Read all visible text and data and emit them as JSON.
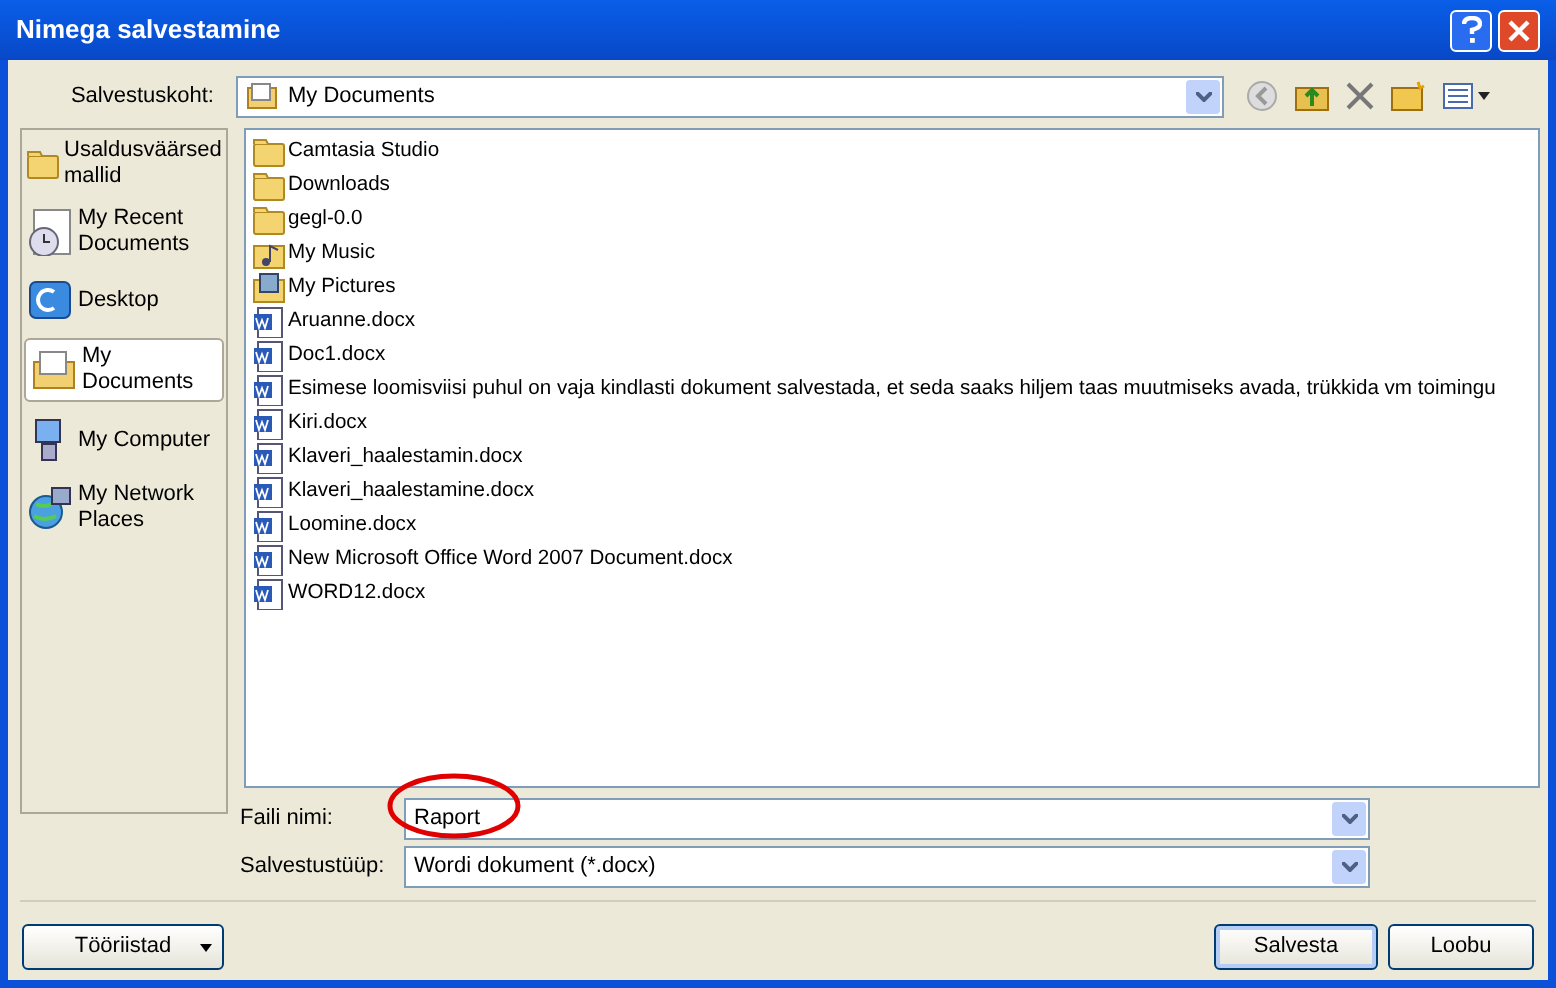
{
  "window": {
    "title": "Nimega salvestamine"
  },
  "location": {
    "label": "Salvestuskoht:",
    "value": "My Documents"
  },
  "places": [
    {
      "label": "Usaldusväärsed mallid",
      "kind": "folder",
      "selected": false
    },
    {
      "label": "My Recent Documents",
      "kind": "recent",
      "selected": false
    },
    {
      "label": "Desktop",
      "kind": "desktop",
      "selected": false
    },
    {
      "label": "My Documents",
      "kind": "documents",
      "selected": true
    },
    {
      "label": "My Computer",
      "kind": "computer",
      "selected": false
    },
    {
      "label": "My Network Places",
      "kind": "network",
      "selected": false
    }
  ],
  "files": [
    {
      "name": "Camtasia Studio",
      "kind": "folder"
    },
    {
      "name": "Downloads",
      "kind": "folder"
    },
    {
      "name": "gegl-0.0",
      "kind": "folder"
    },
    {
      "name": "My Music",
      "kind": "music"
    },
    {
      "name": "My Pictures",
      "kind": "pictures"
    },
    {
      "name": "Aruanne.docx",
      "kind": "doc"
    },
    {
      "name": "Doc1.docx",
      "kind": "doc"
    },
    {
      "name": "Esimese loomisviisi puhul on vaja kindlasti dokument salvestada, et seda saaks hiljem taas muutmiseks avada, trükkida vm toimingu",
      "kind": "doc"
    },
    {
      "name": "Kiri.docx",
      "kind": "doc"
    },
    {
      "name": "Klaveri_haalestamin.docx",
      "kind": "doc"
    },
    {
      "name": "Klaveri_haalestamine.docx",
      "kind": "doc"
    },
    {
      "name": "Loomine.docx",
      "kind": "doc"
    },
    {
      "name": "New Microsoft Office Word 2007 Document.docx",
      "kind": "doc"
    },
    {
      "name": "WORD12.docx",
      "kind": "doc"
    }
  ],
  "filename": {
    "label": "Faili nimi:",
    "value": "Raport",
    "highlighted": true
  },
  "filetype": {
    "label": "Salvestustüüp:",
    "value": "Wordi dokument (*.docx)"
  },
  "buttons": {
    "tools": "Tööriistad",
    "save": "Salvesta",
    "cancel": "Loobu"
  }
}
